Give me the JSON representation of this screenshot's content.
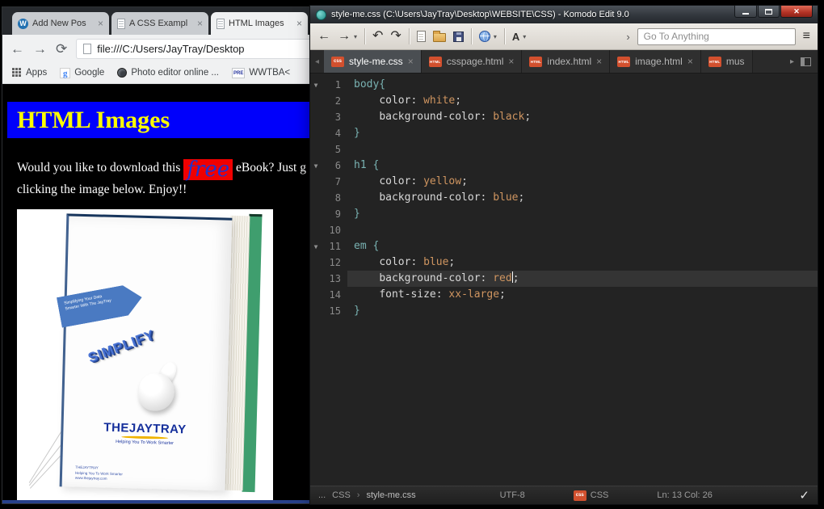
{
  "icons": {
    "back": "←",
    "forward": "→",
    "refresh": "⟳",
    "undo": "↶",
    "redo": "↷",
    "dropdown": "▾",
    "chevron_left": "◂",
    "chevron_right": "›",
    "arrow_right": "▸",
    "hamburger": "≡",
    "close": "×",
    "close_window": "✕",
    "check": "✓",
    "fold": "▼",
    "wordpress": "W",
    "google": "g",
    "a_menu": "A",
    "css_badge": "css",
    "html_badge": "HTML",
    "pre_badge": "PRE"
  },
  "chrome": {
    "tabs": [
      {
        "label": "Add New Pos"
      },
      {
        "label": "A CSS Exampl"
      },
      {
        "label": "HTML Images"
      }
    ],
    "address": "file:///C:/Users/JayTray/Desktop",
    "bookmarks": {
      "apps": "Apps",
      "google": "Google",
      "photo": "Photo editor online ...",
      "wwtba": "WWTBA<"
    },
    "page": {
      "heading": "HTML Images",
      "para_before": "Would you like to download this ",
      "para_em": "free",
      "para_after": " eBook? Just g",
      "para_line2": "clicking the image below. Enjoy!!",
      "book": {
        "ribbon_line1": "Simplifying Your Data",
        "ribbon_line2": "Smarter With The JayTray",
        "simplify": "SIMPLIFY",
        "logo": "THEJAYTRAY",
        "tagline": "Helping You To Work Smarter",
        "print1": "THEJAYTRAY",
        "print2": "Helping You To Work Smarter",
        "print3": "www.thejaytray.com"
      }
    }
  },
  "komodo": {
    "title": "style-me.css (C:\\Users\\JayTray\\Desktop\\WEBSITE\\CSS) - Komodo Edit 9.0",
    "search_placeholder": "Go To Anything",
    "tabs": [
      {
        "label": "style-me.css"
      },
      {
        "label": "csspage.html"
      },
      {
        "label": "index.html"
      },
      {
        "label": "image.html"
      },
      {
        "label": "mus"
      }
    ],
    "status": {
      "dots": "...",
      "lang": "CSS",
      "file": "style-me.css",
      "encoding": "UTF-8",
      "lang_badge": "CSS",
      "position": "Ln: 13 Col: 26"
    },
    "code": [
      {
        "fold": true,
        "tokens": [
          [
            "sel",
            "body{"
          ]
        ]
      },
      {
        "tokens": [
          [
            "pln",
            "    "
          ],
          [
            "prop",
            "color"
          ],
          [
            "pun",
            ": "
          ],
          [
            "val",
            "white"
          ],
          [
            "pun",
            ";"
          ]
        ]
      },
      {
        "tokens": [
          [
            "pln",
            "    "
          ],
          [
            "prop",
            "background-color"
          ],
          [
            "pun",
            ": "
          ],
          [
            "val",
            "black"
          ],
          [
            "pun",
            ";"
          ]
        ]
      },
      {
        "tokens": [
          [
            "sel",
            "}"
          ]
        ]
      },
      {
        "tokens": []
      },
      {
        "fold": true,
        "tokens": [
          [
            "sel",
            "h1 {"
          ]
        ]
      },
      {
        "tokens": [
          [
            "pln",
            "    "
          ],
          [
            "prop",
            "color"
          ],
          [
            "pun",
            ": "
          ],
          [
            "val",
            "yellow"
          ],
          [
            "pun",
            ";"
          ]
        ]
      },
      {
        "tokens": [
          [
            "pln",
            "    "
          ],
          [
            "prop",
            "background-color"
          ],
          [
            "pun",
            ": "
          ],
          [
            "val",
            "blue"
          ],
          [
            "pun",
            ";"
          ]
        ]
      },
      {
        "tokens": [
          [
            "sel",
            "}"
          ]
        ]
      },
      {
        "tokens": []
      },
      {
        "fold": true,
        "tokens": [
          [
            "sel",
            "em {"
          ]
        ]
      },
      {
        "tokens": [
          [
            "pln",
            "    "
          ],
          [
            "prop",
            "color"
          ],
          [
            "pun",
            ": "
          ],
          [
            "val",
            "blue"
          ],
          [
            "pun",
            ";"
          ]
        ]
      },
      {
        "current": true,
        "tokens": [
          [
            "pln",
            "    "
          ],
          [
            "prop",
            "background-color"
          ],
          [
            "pun",
            ": "
          ],
          [
            "val",
            "red"
          ],
          [
            "caret",
            ""
          ],
          [
            "pun",
            ";"
          ]
        ]
      },
      {
        "tokens": [
          [
            "pln",
            "    "
          ],
          [
            "prop",
            "font-size"
          ],
          [
            "pun",
            ": "
          ],
          [
            "val",
            "xx-large"
          ],
          [
            "pun",
            ";"
          ]
        ]
      },
      {
        "tokens": [
          [
            "sel",
            "}"
          ]
        ]
      }
    ]
  }
}
